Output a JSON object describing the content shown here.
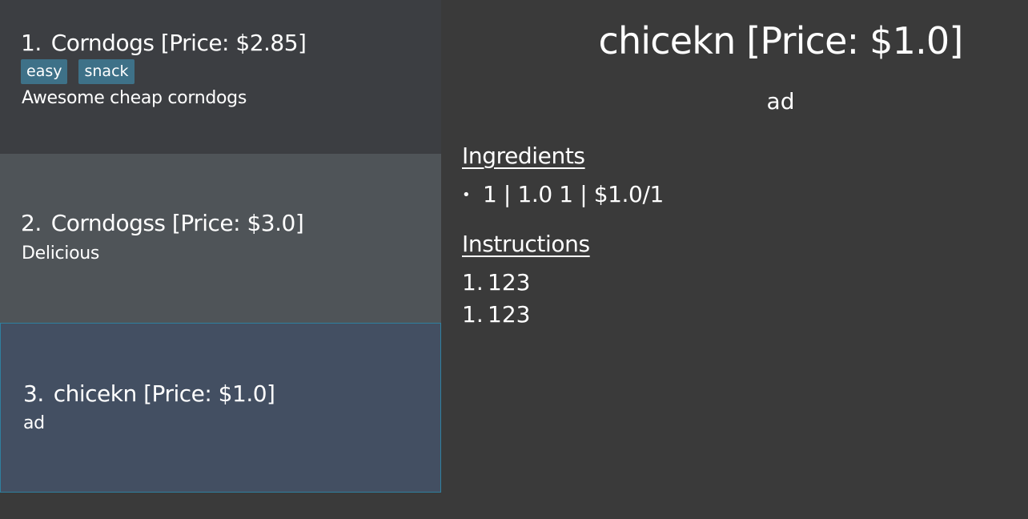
{
  "recipes": [
    {
      "index": "1.",
      "title": "Corndogs [Price: $2.85]",
      "tags": [
        "easy",
        "snack"
      ],
      "description": "Awesome cheap corndogs"
    },
    {
      "index": "2.",
      "title": "Corndogss [Price: $3.0]",
      "tags": [],
      "description": "Delicious"
    },
    {
      "index": "3.",
      "title": "chicekn [Price: $1.0]",
      "tags": [],
      "description": "ad"
    }
  ],
  "detail": {
    "title": "chicekn [Price: $1.0]",
    "description": "ad",
    "ingredients_heading": "Ingredients",
    "ingredients": [
      {
        "bullet": "•",
        "text": "1 | 1.0 1 | $1.0/1"
      }
    ],
    "instructions_heading": "Instructions",
    "instructions": [
      {
        "number": "1.",
        "text": "123"
      },
      {
        "number": "1.",
        "text": "123"
      }
    ]
  },
  "colors": {
    "background": "#3a3a3a",
    "card_default": "#3c3e42",
    "card_hover": "#4f5458",
    "card_selected": "#434f62",
    "selected_border": "#2f7f9e",
    "tag_background": "#3e7188"
  }
}
